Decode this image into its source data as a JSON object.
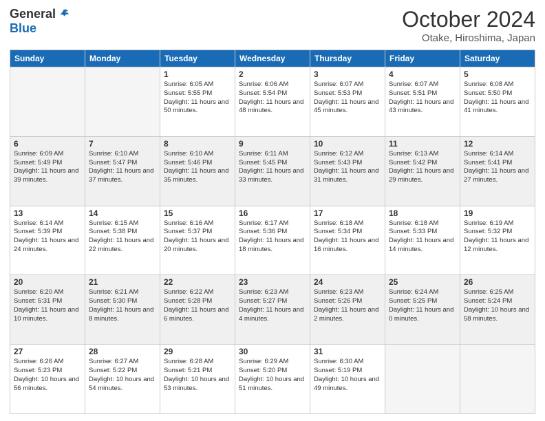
{
  "logo": {
    "general": "General",
    "blue": "Blue"
  },
  "title": "October 2024",
  "location": "Otake, Hiroshima, Japan",
  "days_of_week": [
    "Sunday",
    "Monday",
    "Tuesday",
    "Wednesday",
    "Thursday",
    "Friday",
    "Saturday"
  ],
  "weeks": [
    [
      {
        "day": "",
        "empty": true
      },
      {
        "day": "",
        "empty": true
      },
      {
        "day": "1",
        "sunrise": "Sunrise: 6:05 AM",
        "sunset": "Sunset: 5:55 PM",
        "daylight": "Daylight: 11 hours and 50 minutes."
      },
      {
        "day": "2",
        "sunrise": "Sunrise: 6:06 AM",
        "sunset": "Sunset: 5:54 PM",
        "daylight": "Daylight: 11 hours and 48 minutes."
      },
      {
        "day": "3",
        "sunrise": "Sunrise: 6:07 AM",
        "sunset": "Sunset: 5:53 PM",
        "daylight": "Daylight: 11 hours and 45 minutes."
      },
      {
        "day": "4",
        "sunrise": "Sunrise: 6:07 AM",
        "sunset": "Sunset: 5:51 PM",
        "daylight": "Daylight: 11 hours and 43 minutes."
      },
      {
        "day": "5",
        "sunrise": "Sunrise: 6:08 AM",
        "sunset": "Sunset: 5:50 PM",
        "daylight": "Daylight: 11 hours and 41 minutes."
      }
    ],
    [
      {
        "day": "6",
        "sunrise": "Sunrise: 6:09 AM",
        "sunset": "Sunset: 5:49 PM",
        "daylight": "Daylight: 11 hours and 39 minutes."
      },
      {
        "day": "7",
        "sunrise": "Sunrise: 6:10 AM",
        "sunset": "Sunset: 5:47 PM",
        "daylight": "Daylight: 11 hours and 37 minutes."
      },
      {
        "day": "8",
        "sunrise": "Sunrise: 6:10 AM",
        "sunset": "Sunset: 5:46 PM",
        "daylight": "Daylight: 11 hours and 35 minutes."
      },
      {
        "day": "9",
        "sunrise": "Sunrise: 6:11 AM",
        "sunset": "Sunset: 5:45 PM",
        "daylight": "Daylight: 11 hours and 33 minutes."
      },
      {
        "day": "10",
        "sunrise": "Sunrise: 6:12 AM",
        "sunset": "Sunset: 5:43 PM",
        "daylight": "Daylight: 11 hours and 31 minutes."
      },
      {
        "day": "11",
        "sunrise": "Sunrise: 6:13 AM",
        "sunset": "Sunset: 5:42 PM",
        "daylight": "Daylight: 11 hours and 29 minutes."
      },
      {
        "day": "12",
        "sunrise": "Sunrise: 6:14 AM",
        "sunset": "Sunset: 5:41 PM",
        "daylight": "Daylight: 11 hours and 27 minutes."
      }
    ],
    [
      {
        "day": "13",
        "sunrise": "Sunrise: 6:14 AM",
        "sunset": "Sunset: 5:39 PM",
        "daylight": "Daylight: 11 hours and 24 minutes."
      },
      {
        "day": "14",
        "sunrise": "Sunrise: 6:15 AM",
        "sunset": "Sunset: 5:38 PM",
        "daylight": "Daylight: 11 hours and 22 minutes."
      },
      {
        "day": "15",
        "sunrise": "Sunrise: 6:16 AM",
        "sunset": "Sunset: 5:37 PM",
        "daylight": "Daylight: 11 hours and 20 minutes."
      },
      {
        "day": "16",
        "sunrise": "Sunrise: 6:17 AM",
        "sunset": "Sunset: 5:36 PM",
        "daylight": "Daylight: 11 hours and 18 minutes."
      },
      {
        "day": "17",
        "sunrise": "Sunrise: 6:18 AM",
        "sunset": "Sunset: 5:34 PM",
        "daylight": "Daylight: 11 hours and 16 minutes."
      },
      {
        "day": "18",
        "sunrise": "Sunrise: 6:18 AM",
        "sunset": "Sunset: 5:33 PM",
        "daylight": "Daylight: 11 hours and 14 minutes."
      },
      {
        "day": "19",
        "sunrise": "Sunrise: 6:19 AM",
        "sunset": "Sunset: 5:32 PM",
        "daylight": "Daylight: 11 hours and 12 minutes."
      }
    ],
    [
      {
        "day": "20",
        "sunrise": "Sunrise: 6:20 AM",
        "sunset": "Sunset: 5:31 PM",
        "daylight": "Daylight: 11 hours and 10 minutes."
      },
      {
        "day": "21",
        "sunrise": "Sunrise: 6:21 AM",
        "sunset": "Sunset: 5:30 PM",
        "daylight": "Daylight: 11 hours and 8 minutes."
      },
      {
        "day": "22",
        "sunrise": "Sunrise: 6:22 AM",
        "sunset": "Sunset: 5:28 PM",
        "daylight": "Daylight: 11 hours and 6 minutes."
      },
      {
        "day": "23",
        "sunrise": "Sunrise: 6:23 AM",
        "sunset": "Sunset: 5:27 PM",
        "daylight": "Daylight: 11 hours and 4 minutes."
      },
      {
        "day": "24",
        "sunrise": "Sunrise: 6:23 AM",
        "sunset": "Sunset: 5:26 PM",
        "daylight": "Daylight: 11 hours and 2 minutes."
      },
      {
        "day": "25",
        "sunrise": "Sunrise: 6:24 AM",
        "sunset": "Sunset: 5:25 PM",
        "daylight": "Daylight: 11 hours and 0 minutes."
      },
      {
        "day": "26",
        "sunrise": "Sunrise: 6:25 AM",
        "sunset": "Sunset: 5:24 PM",
        "daylight": "Daylight: 10 hours and 58 minutes."
      }
    ],
    [
      {
        "day": "27",
        "sunrise": "Sunrise: 6:26 AM",
        "sunset": "Sunset: 5:23 PM",
        "daylight": "Daylight: 10 hours and 56 minutes."
      },
      {
        "day": "28",
        "sunrise": "Sunrise: 6:27 AM",
        "sunset": "Sunset: 5:22 PM",
        "daylight": "Daylight: 10 hours and 54 minutes."
      },
      {
        "day": "29",
        "sunrise": "Sunrise: 6:28 AM",
        "sunset": "Sunset: 5:21 PM",
        "daylight": "Daylight: 10 hours and 53 minutes."
      },
      {
        "day": "30",
        "sunrise": "Sunrise: 6:29 AM",
        "sunset": "Sunset: 5:20 PM",
        "daylight": "Daylight: 10 hours and 51 minutes."
      },
      {
        "day": "31",
        "sunrise": "Sunrise: 6:30 AM",
        "sunset": "Sunset: 5:19 PM",
        "daylight": "Daylight: 10 hours and 49 minutes."
      },
      {
        "day": "",
        "empty": true
      },
      {
        "day": "",
        "empty": true
      }
    ]
  ]
}
